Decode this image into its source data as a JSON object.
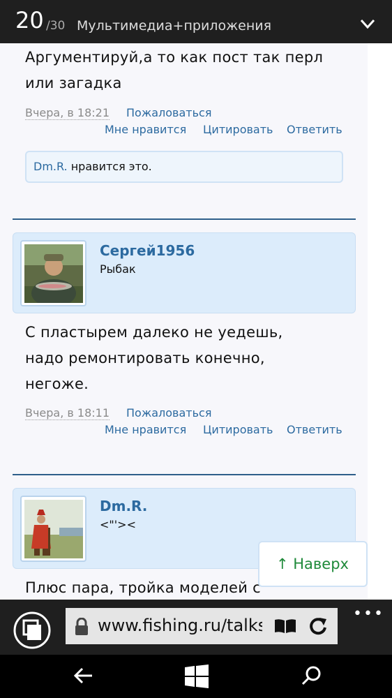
{
  "header": {
    "page_current": "20",
    "page_total": "/30",
    "forum_name": "Мультимедиа+приложения"
  },
  "posts": [
    {
      "text_lines": [
        "Аргументируй,а то как пост так перл",
        "или загадка"
      ],
      "date": "Вчера, в 18:21",
      "report": "Пожаловаться",
      "like": "Мне нравится",
      "quote": "Цитировать",
      "reply": "Ответить",
      "likes_user": "Dm.R.",
      "likes_text": " нравится это."
    },
    {
      "author": "Сергей1956",
      "rank": "Рыбак",
      "text_lines": [
        "С пластырем далеко не уедешь,",
        "надо ремонтировать конечно,",
        "негоже."
      ],
      "date": "Вчера, в 18:11",
      "report": "Пожаловаться",
      "like": "Мне нравится",
      "quote": "Цитировать",
      "reply": "Ответить"
    },
    {
      "author": "Dm.R.",
      "rank": "<\"'><",
      "text_lines": [
        "Плюс пара, тройка моделей с"
      ]
    }
  ],
  "scroll_top_button": "↑ Наверх",
  "browser": {
    "url": "www.fishing.ru/talks",
    "more": "•••"
  },
  "colors": {
    "link": "#2c6aa0",
    "author_bg": "#dcecfb",
    "separator": "#2e5f8a",
    "top_button_text": "#1f8a3a"
  }
}
